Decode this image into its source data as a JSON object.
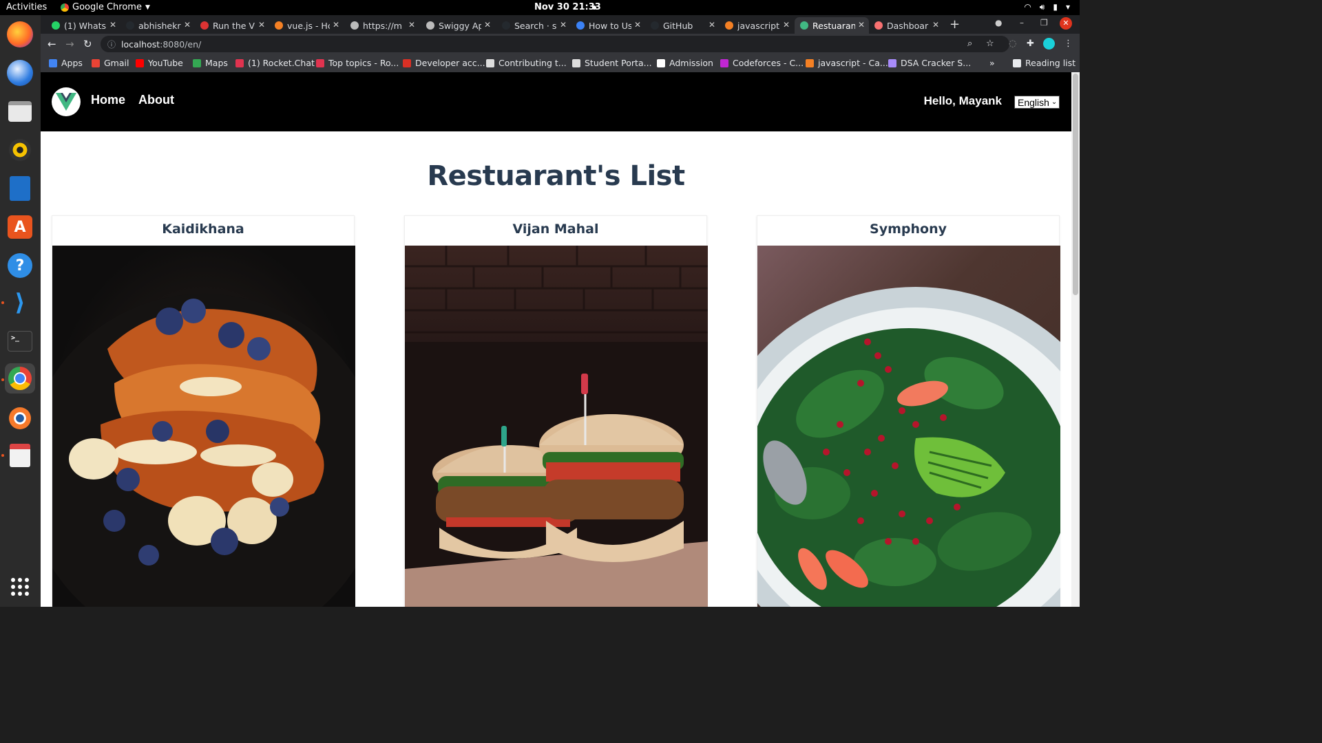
{
  "system": {
    "activities": "Activities",
    "app_name": "Google Chrome",
    "clock": "Nov 30  21:33"
  },
  "dock": {
    "apps": [
      "firefox-icon",
      "thunderbird-icon",
      "files-icon",
      "rhythmbox-icon",
      "writer-icon",
      "software-icon",
      "help-icon",
      "vscode-icon",
      "terminal-icon",
      "chrome-icon",
      "blender-icon",
      "reader-icon"
    ]
  },
  "tabs": [
    {
      "title": "(1) Whats",
      "color": "#25d366"
    },
    {
      "title": "abhishekr",
      "color": "#24292e"
    },
    {
      "title": "Run the V",
      "color": "#d33"
    },
    {
      "title": "vue.js - Hc",
      "color": "#f48024"
    },
    {
      "title": "https://m",
      "color": "#bbb"
    },
    {
      "title": "Swiggy Ap",
      "color": "#bbb"
    },
    {
      "title": "Search · sv",
      "color": "#24292e"
    },
    {
      "title": "How to Us",
      "color": "#3b82f6"
    },
    {
      "title": "GitHub",
      "color": "#24292e"
    },
    {
      "title": "javascript",
      "color": "#f48024"
    },
    {
      "title": "Restuaran",
      "color": "#41b883"
    },
    {
      "title": "Dashboar",
      "color": "#f87171"
    }
  ],
  "address": {
    "host": "localhost",
    "rest": ":8080/en/"
  },
  "bookmarks": [
    {
      "label": "Apps",
      "color": "#4285f4"
    },
    {
      "label": "Gmail",
      "color": "#ea4335"
    },
    {
      "label": "YouTube",
      "color": "#ff0000"
    },
    {
      "label": "Maps",
      "color": "#34a853"
    },
    {
      "label": "(1) Rocket.Chat",
      "color": "#e0334f"
    },
    {
      "label": "Top topics - Ro...",
      "color": "#e0334f"
    },
    {
      "label": "Developer acc...",
      "color": "#d93025"
    },
    {
      "label": "Contributing t...",
      "color": "#dddddd"
    },
    {
      "label": "Student Porta...",
      "color": "#dddddd"
    },
    {
      "label": "Admission",
      "color": "#ffffff"
    },
    {
      "label": "Codeforces - C...",
      "color": "#c026d3"
    },
    {
      "label": "javascript - Ca...",
      "color": "#f48024"
    },
    {
      "label": "DSA Cracker S...",
      "color": "#a78bfa"
    }
  ],
  "reading_list": "Reading list",
  "site": {
    "nav": {
      "home": "Home",
      "about": "About",
      "greeting": "Hello, Mayank",
      "language": "English"
    },
    "heading": "Restuarant's List",
    "restaurants": [
      {
        "name": "Kaidikhana",
        "image": "french-toast-with-berries-and-banana"
      },
      {
        "name": "Vijan Mahal",
        "image": "burgers-on-paper"
      },
      {
        "name": "Symphony",
        "image": "salad-with-pomegranate-and-avocado"
      }
    ]
  }
}
